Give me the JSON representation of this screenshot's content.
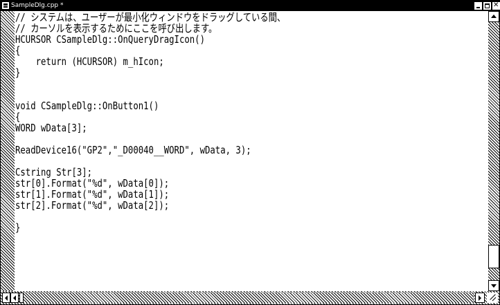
{
  "window": {
    "title": "SampleDlg.cpp *",
    "file_icon": "document-icon",
    "controls": [
      "minimize-icon",
      "maximize-icon",
      "close-icon"
    ]
  },
  "editor": {
    "lines": [
      "// システムは、ユーザーが最小化ウィンドウをドラッグしている間、",
      "// カーソルを表示するためにここを呼び出します。",
      "HCURSOR CSampleDlg::OnQueryDragIcon()",
      "{",
      "    return (HCURSOR) m_hIcon;",
      "}",
      "",
      "",
      "void CSampleDlg::OnButton1()",
      "{",
      "WORD wData[3];",
      "",
      "ReadDevice16(\"GP2\",\"_D00040__WORD\", wData, 3);",
      "",
      "Cstring Str[3];",
      "str[0].Format(\"%d\", wData[0]);",
      "str[1].Format(\"%d\", wData[1]);",
      "str[2].Format(\"%d\", wData[2]);",
      "",
      "}"
    ]
  },
  "scrollbars": {
    "vertical_position": 0.9,
    "horizontal_position": 0.0
  }
}
